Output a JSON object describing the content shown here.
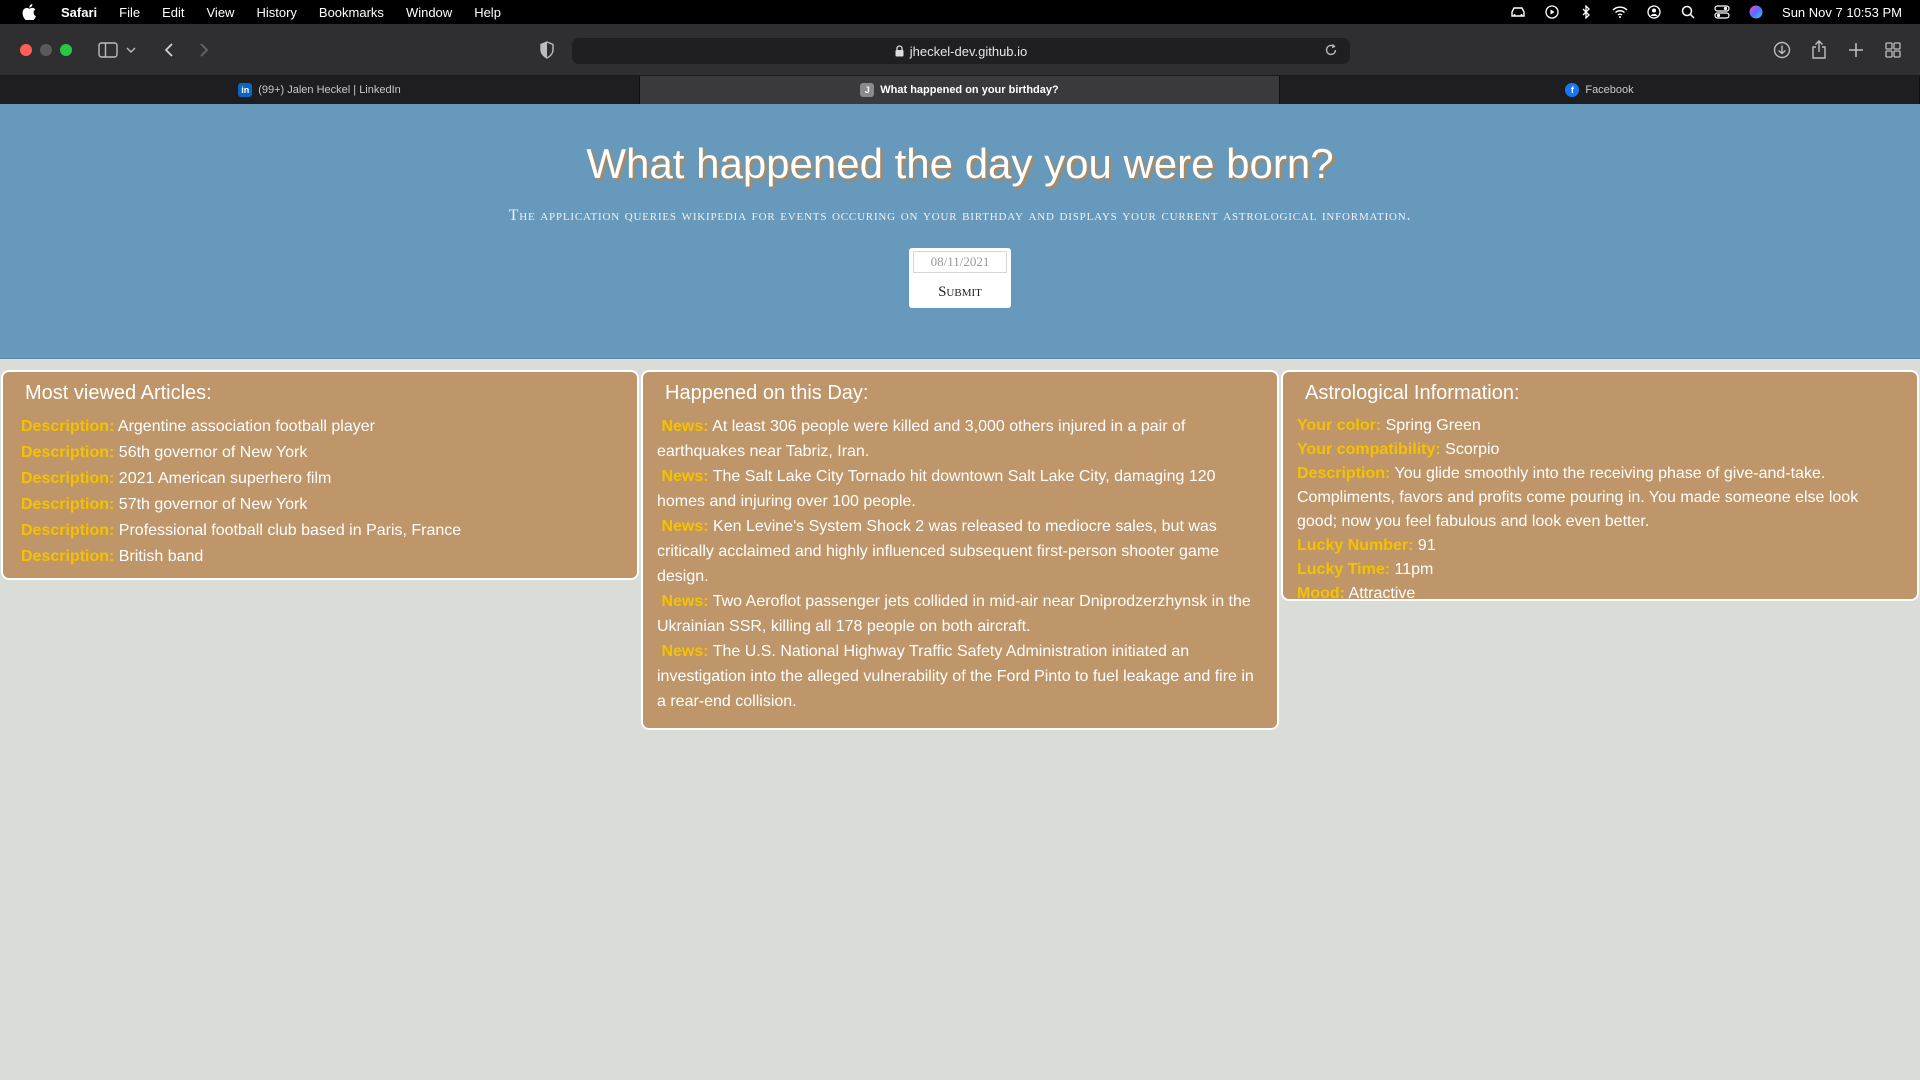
{
  "menubar": {
    "app": "Safari",
    "items": [
      "File",
      "Edit",
      "View",
      "History",
      "Bookmarks",
      "Window",
      "Help"
    ],
    "clock": "Sun Nov 7  10:53 PM"
  },
  "browser": {
    "url": "jheckel-dev.github.io",
    "tabs": [
      {
        "label": "(99+) Jalen Heckel | LinkedIn",
        "icon": "linkedin-icon",
        "active": false
      },
      {
        "label": "What happened on your birthday?",
        "icon": "J",
        "active": true
      },
      {
        "label": "Facebook",
        "icon": "facebook-icon",
        "active": false
      }
    ]
  },
  "page": {
    "title": "What happened the day you were born?",
    "subtitle": "The application queries wikipedia for events occuring on your birthday and displays your current astrological information.",
    "date_value": "08/11/2021",
    "submit_label": "Submit"
  },
  "articles": {
    "title": "Most viewed Articles:",
    "key_label": "Description:",
    "items": [
      "Argentine association football player",
      "56th governor of New York",
      "2021 American superhero film",
      "57th governor of New York",
      "Professional football club based in Paris, France",
      "British band"
    ]
  },
  "events": {
    "title": "Happened on this Day:",
    "key_label": "News:",
    "items": [
      "At least 306 people were killed and 3,000 others injured in a pair of earthquakes near Tabriz, Iran.",
      "The Salt Lake City Tornado hit downtown Salt Lake City, damaging 120 homes and injuring over 100 people.",
      "Ken Levine's System Shock 2 was released to mediocre sales, but was critically acclaimed and highly influenced subsequent first-person shooter game design.",
      "Two Aeroflot passenger jets collided in mid-air near Dniprodzerzhynsk in the Ukrainian SSR, killing all 178 people on both aircraft.",
      "The U.S. National Highway Traffic Safety Administration initiated an investigation into the alleged vulnerability of the Ford Pinto to fuel leakage and fire in a rear-end collision."
    ]
  },
  "astrology": {
    "title": "Astrological Information:",
    "color_label": "Your color:",
    "color_value": "Spring Green",
    "compat_label": "Your compatibility:",
    "compat_value": "Scorpio",
    "desc_label": "Description:",
    "desc_value": "You glide smoothly into the receiving phase of give-and-take. Compliments, favors and profits come pouring in. You made someone else look good; now you feel fabulous and look even better.",
    "number_label": "Lucky Number:",
    "number_value": "91",
    "time_label": "Lucky Time:",
    "time_value": "11pm",
    "mood_label": "Mood:",
    "mood_value": "Attractive"
  }
}
